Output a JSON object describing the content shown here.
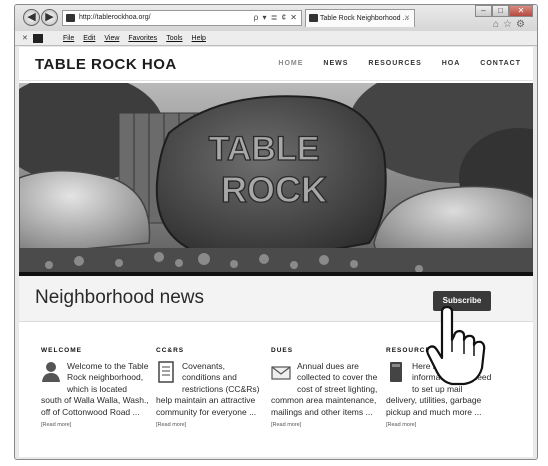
{
  "browser": {
    "url": "http://tablerockhoa.org/",
    "address_icons": "ρ ▾ ≣ ¢ ✕",
    "tab_title": "Table Rock Neighborhood ...",
    "tab_close": "✕",
    "back": "◀",
    "forward": "▶",
    "win_min": "–",
    "win_max": "□",
    "win_close": "✕",
    "right_icons": "⌂☆⚙",
    "menu_close": "✕",
    "menu": [
      "File",
      "Edit",
      "View",
      "Favorites",
      "Tools",
      "Help"
    ]
  },
  "site": {
    "logo": "TABLE ROCK HOA",
    "nav": [
      "HOME",
      "NEWS",
      "RESOURCES",
      "HOA",
      "CONTACT"
    ],
    "hero_text_1": "TABLE",
    "hero_text_2": "ROCK"
  },
  "news": {
    "title": "Neighborhood news",
    "subscribe": "Subscribe"
  },
  "columns": [
    {
      "heading": "WELCOME",
      "icon": "person-icon",
      "text": "Welcome to the Table Rock neighborhood, which is located south of Walla Walla, Wash., off of Cottonwood Road ...",
      "more": "[Read more]"
    },
    {
      "heading": "CC&RS",
      "icon": "document-icon",
      "text": "Covenants, conditions and restrictions (CC&Rs) help maintain an attractive community for everyone ...",
      "more": "[Read more]"
    },
    {
      "heading": "DUES",
      "icon": "envelope-icon",
      "text": "Annual dues are collected to cover the cost of street lighting, common area maintenance, mailings and other items ...",
      "more": "[Read more]"
    },
    {
      "heading": "RESOURCES",
      "icon": "book-icon",
      "text": "Here is contact information you need to set up mail delivery, utilities, garbage pickup and much more ...",
      "more": "[Read more]"
    }
  ],
  "colors": {
    "subscribe_bg": "#3a3a3a",
    "news_bar_bg": "#f3f3f3"
  }
}
